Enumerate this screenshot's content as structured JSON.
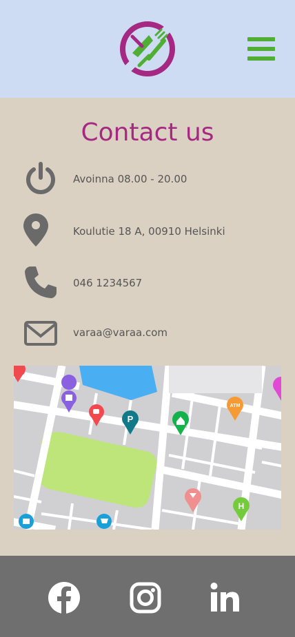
{
  "header": {
    "logo_icon": "restaurant-logo-icon",
    "menu_icon": "hamburger-menu-icon"
  },
  "contact": {
    "title": "Contact us",
    "items": [
      {
        "icon": "power-icon",
        "text": "Avoinna 08.00 - 20.00"
      },
      {
        "icon": "location-pin-icon",
        "text": "Koulutie 18 A, 00910 Helsinki"
      },
      {
        "icon": "phone-icon",
        "text": "046 1234567"
      },
      {
        "icon": "mail-icon",
        "text": "varaa@varaa.com"
      }
    ]
  },
  "map": {
    "pin_labels": [
      "P",
      "ATM",
      "H"
    ]
  },
  "footer": {
    "social": [
      "facebook-icon",
      "instagram-icon",
      "linkedin-icon"
    ]
  },
  "colors": {
    "header_bg": "#cddcf3",
    "main_bg": "#dbd1c3",
    "footer_bg": "#6f6f6f",
    "accent_purple": "#a52882",
    "accent_green": "#4fae33",
    "icon_gray": "#6a6a6a"
  }
}
